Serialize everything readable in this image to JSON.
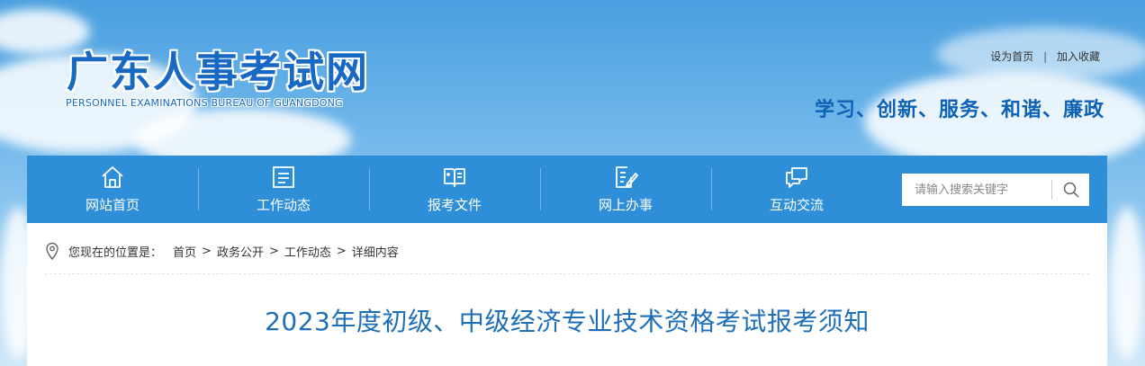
{
  "site": {
    "title": "广东人事考试网",
    "subtitle": "PERSONNEL EXAMINATIONS BUREAU OF GUANGDONG",
    "slogan": "学习、创新、服务、和谐、廉政"
  },
  "top_links": {
    "set_home": "设为首页",
    "separator": "|",
    "add_favorite": "加入收藏"
  },
  "nav": {
    "items": [
      {
        "label": "网站首页",
        "icon": "home-icon"
      },
      {
        "label": "工作动态",
        "icon": "news-list-icon"
      },
      {
        "label": "报考文件",
        "icon": "open-book-icon"
      },
      {
        "label": "网上办事",
        "icon": "document-edit-icon"
      },
      {
        "label": "互动交流",
        "icon": "chat-bubbles-icon"
      }
    ],
    "search": {
      "placeholder": "请输入搜索关键字",
      "value": "",
      "icon": "search-icon"
    }
  },
  "breadcrumb": {
    "icon": "location-pin-icon",
    "prefix": "您现在的位置是：",
    "items": [
      "首页",
      "政务公开",
      "工作动态",
      "详细内容"
    ]
  },
  "article": {
    "title": "2023年度初级、中级经济专业技术资格考试报考须知"
  },
  "colors": {
    "brand_blue": "#1769c3",
    "nav_bar": "#2e8fd8",
    "title_blue": "#1e6fb8"
  }
}
